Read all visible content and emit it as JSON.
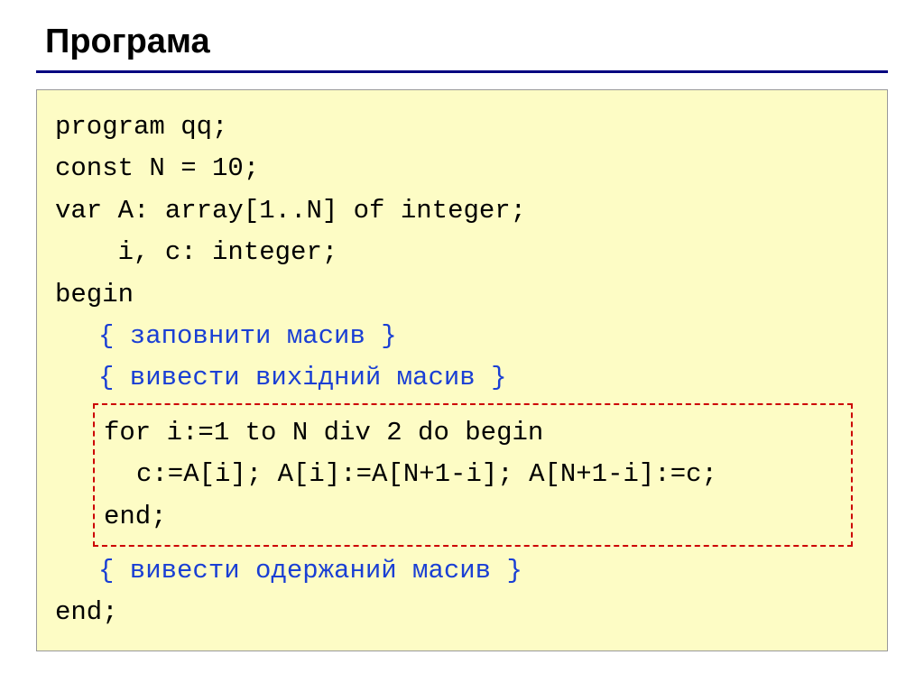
{
  "title": "Програма",
  "code": {
    "line1": "program qq;",
    "line2": "const N = 10;",
    "line3": "var A: array[1..N] of integer;",
    "line4": "    i, c: integer;",
    "line5": "begin",
    "comment1": "{ заповнити масив }",
    "comment2": "{ вивести вихідний масив }",
    "hl1": "for i:=1 to N div 2 do begin",
    "hl2": "c:=A[i]; A[i]:=A[N+1-i]; A[N+1-i]:=c;",
    "hl3": "end;",
    "comment3": "{ вивести одержаний масив }",
    "lineEnd": "end;"
  }
}
